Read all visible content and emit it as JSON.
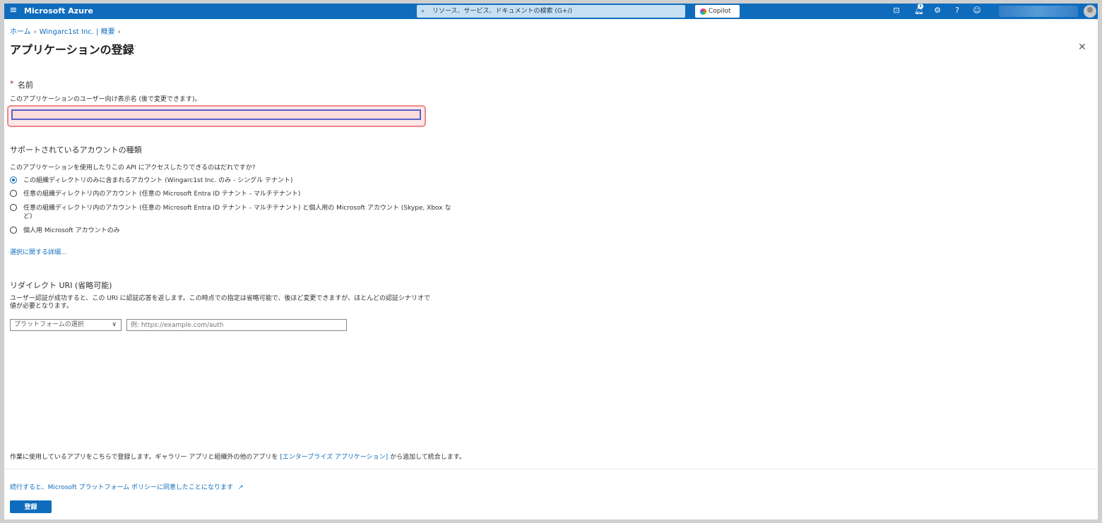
{
  "topbar": {
    "brand": "Microsoft Azure",
    "search_placeholder": "リソース、サービス、ドキュメントの検索 (G+/)",
    "copilot_label": "Copilot",
    "notification_count": "1",
    "accent_color": "#0f6cbd"
  },
  "breadcrumb": {
    "home": "ホーム",
    "tenant": "Wingarc1st Inc. | 概要"
  },
  "page": {
    "title": "アプリケーションの登録",
    "more": "···"
  },
  "name_section": {
    "required_mark": "*",
    "label": "名前",
    "description": "このアプリケーションのユーザー向け表示名 (後で変更できます)。",
    "value": ""
  },
  "account_types": {
    "heading": "サポートされているアカウントの種類",
    "question": "このアプリケーションを使用したりこの API にアクセスしたりできるのはだれですか?",
    "options": [
      {
        "label": "この組織ディレクトリのみに含まれるアカウント (Wingarc1st Inc. のみ - シングル テナント)",
        "selected": true
      },
      {
        "label": "任意の組織ディレクトリ内のアカウント (任意の Microsoft Entra ID テナント - マルチテナント)",
        "selected": false
      },
      {
        "label": "任意の組織ディレクトリ内のアカウント (任意の Microsoft Entra ID テナント - マルチテナント) と個人用の Microsoft アカウント (Skype, Xbox な",
        "label_cont": "ど)",
        "selected": false
      },
      {
        "label": "個人用 Microsoft アカウントのみ",
        "selected": false
      }
    ],
    "details_link": "選択に関する詳細..."
  },
  "redirect": {
    "heading": "リダイレクト URI (省略可能)",
    "description": "ユーザー認証が成功すると、この URI に認証応答を返します。この時点での指定は省略可能で、後ほど変更できますが、ほとんどの認証シナリオで値が必要となります。",
    "platform_selected": "プラットフォームの選択",
    "uri_placeholder": "例: https://example.com/auth"
  },
  "footer": {
    "note_before": "作業に使用しているアプリをこちらで登録します。ギャラリー アプリと組織外の他のアプリを ",
    "note_link": "[エンタープライズ アプリケーション]",
    "note_after": " から追加して統合します。",
    "policy_link": "続行すると、Microsoft プラットフォーム ポリシーに同意したことになります",
    "register_label": "登録"
  }
}
